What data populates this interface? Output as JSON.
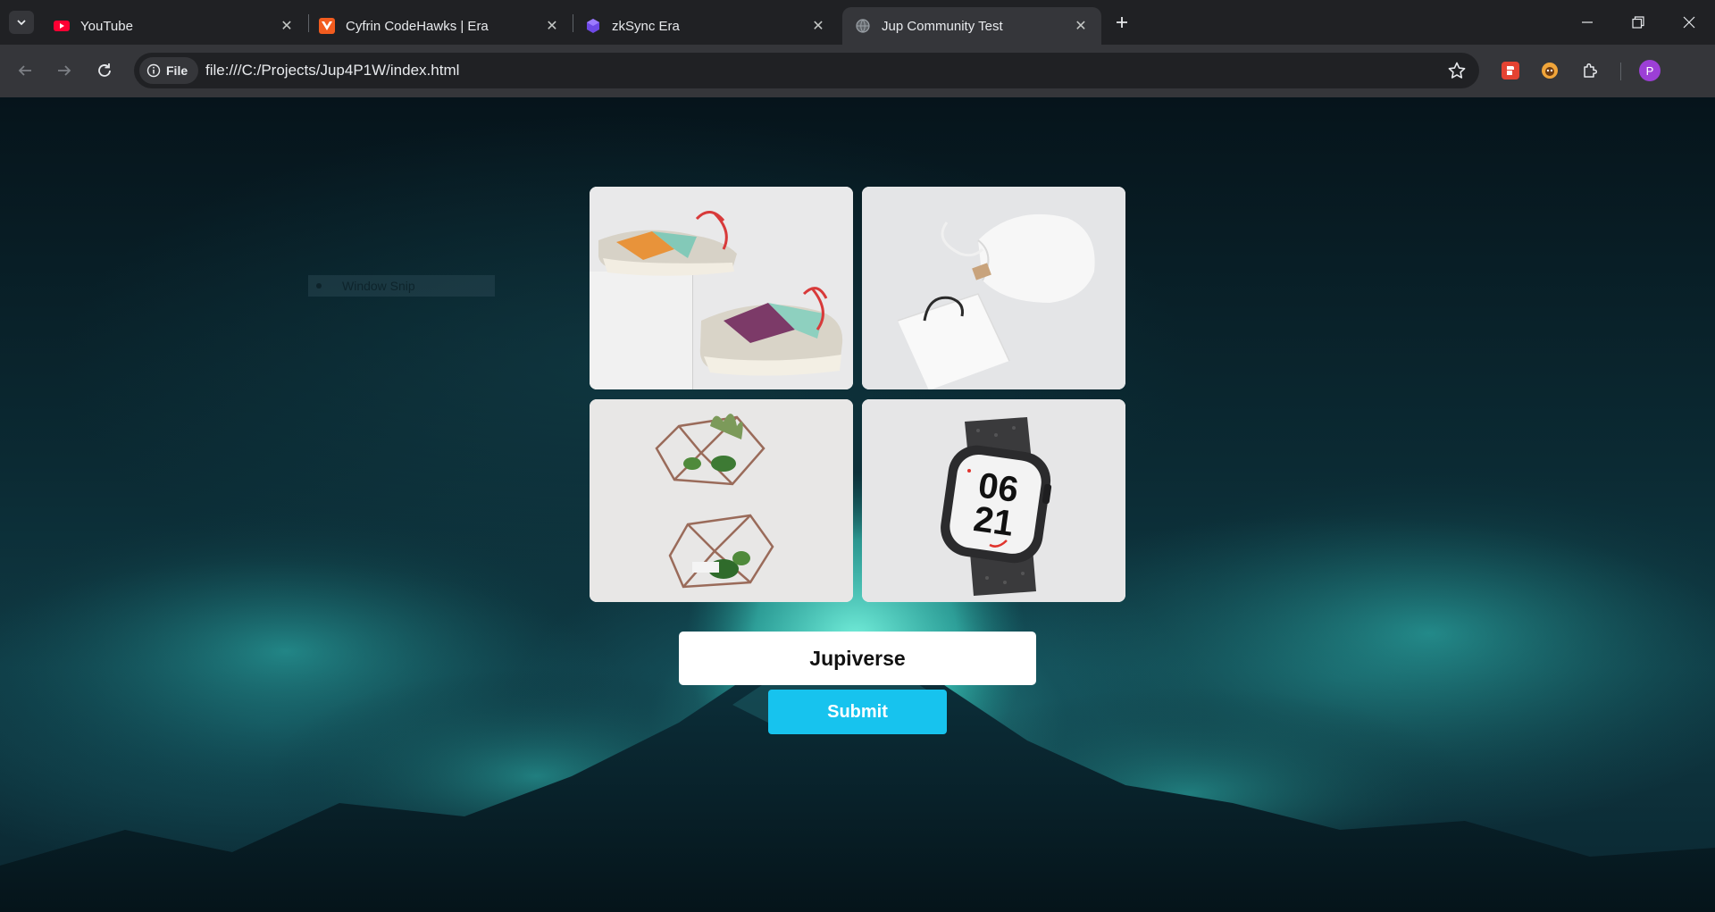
{
  "browser": {
    "tabs": [
      {
        "title": "YouTube",
        "favicon": "youtube-icon",
        "active": false
      },
      {
        "title": "Cyfrin CodeHawks | Era",
        "favicon": "codehawks-icon",
        "active": false
      },
      {
        "title": "zkSync Era",
        "favicon": "zksync-icon",
        "active": false
      },
      {
        "title": "Jup Community Test",
        "favicon": "globe-icon",
        "active": true
      }
    ],
    "address": {
      "chip_label": "File",
      "url": "file:///C:/Projects/Jup4P1W/index.html"
    },
    "profile_initial": "P",
    "colors": {
      "tabstrip": "#202124",
      "toolbar": "#35363a",
      "avatar": "#9c3fd6"
    }
  },
  "page": {
    "snip_label": "Window Snip",
    "images": [
      {
        "subject": "sneakers-photo"
      },
      {
        "subject": "bag-and-pouch-photo"
      },
      {
        "subject": "geometric-planters-photo"
      },
      {
        "subject": "smartwatch-photo",
        "watch_face": [
          "06",
          "21"
        ]
      }
    ],
    "input": {
      "value": "Jupiverse"
    },
    "submit_label": "Submit",
    "colors": {
      "submit": "#17c3ee",
      "input_bg": "#ffffff"
    }
  }
}
